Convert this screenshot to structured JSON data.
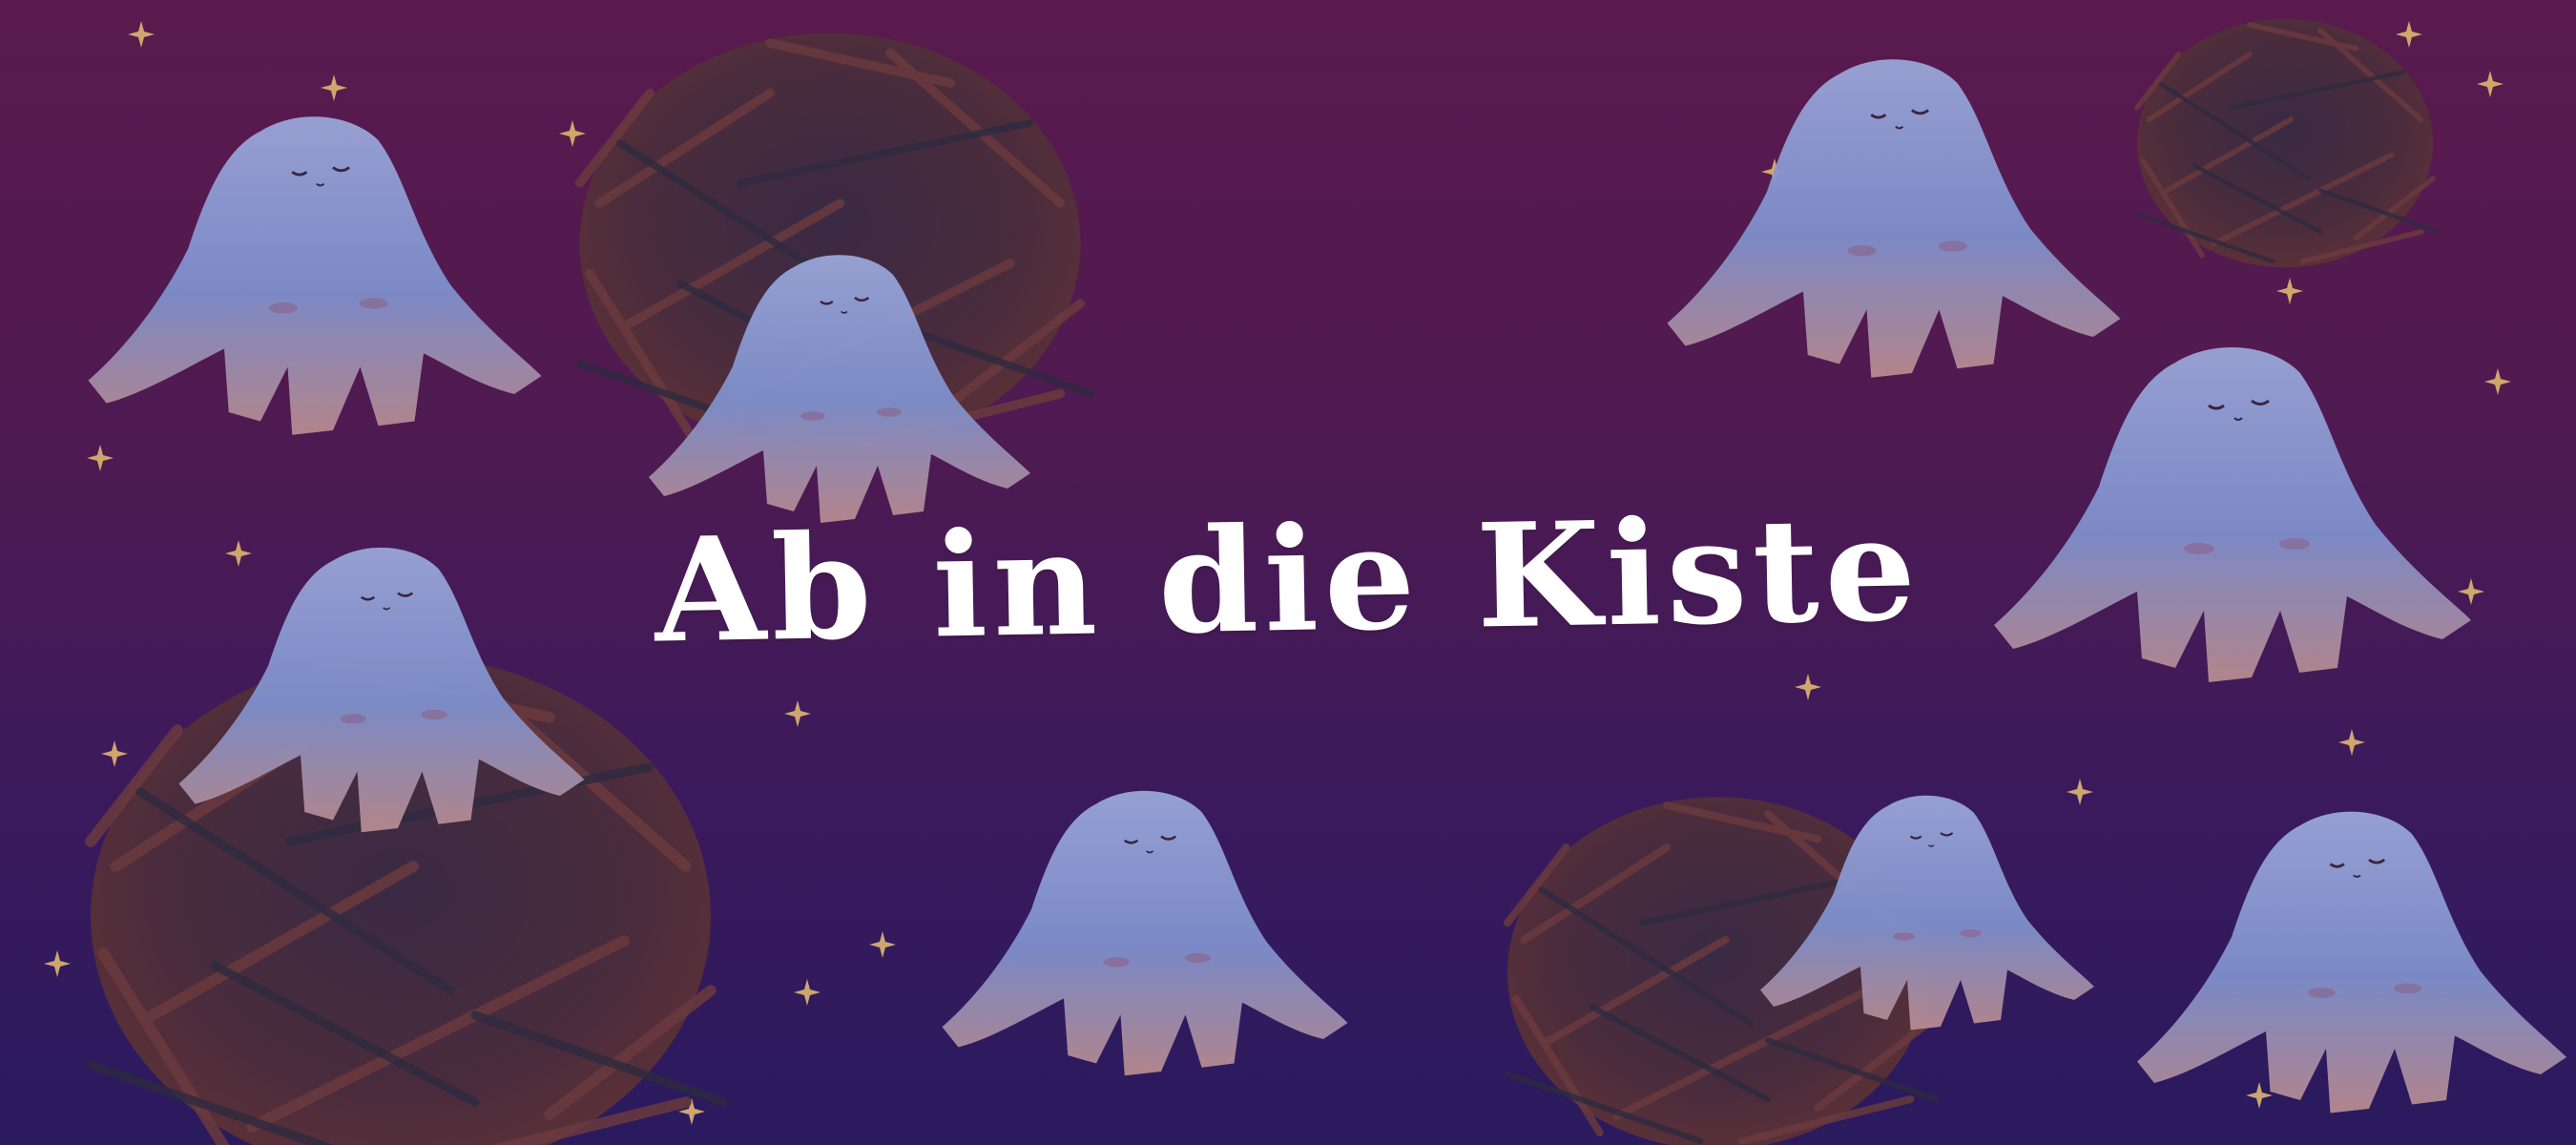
{
  "title": "Ab in die Kiste",
  "colors": {
    "background_top": "#5a1a4e",
    "background_bottom": "#2a1a5e",
    "ghost": "#8f9fd0",
    "ghost_shadow": "#b07a8a",
    "nest": "#4a2a3a",
    "star": "#e8c070",
    "title_text": "#ffffff"
  },
  "elements": {
    "ghost_icon": "ghost-creature",
    "nest_icon": "twig-nest",
    "star_icon": "sparkle-star"
  }
}
